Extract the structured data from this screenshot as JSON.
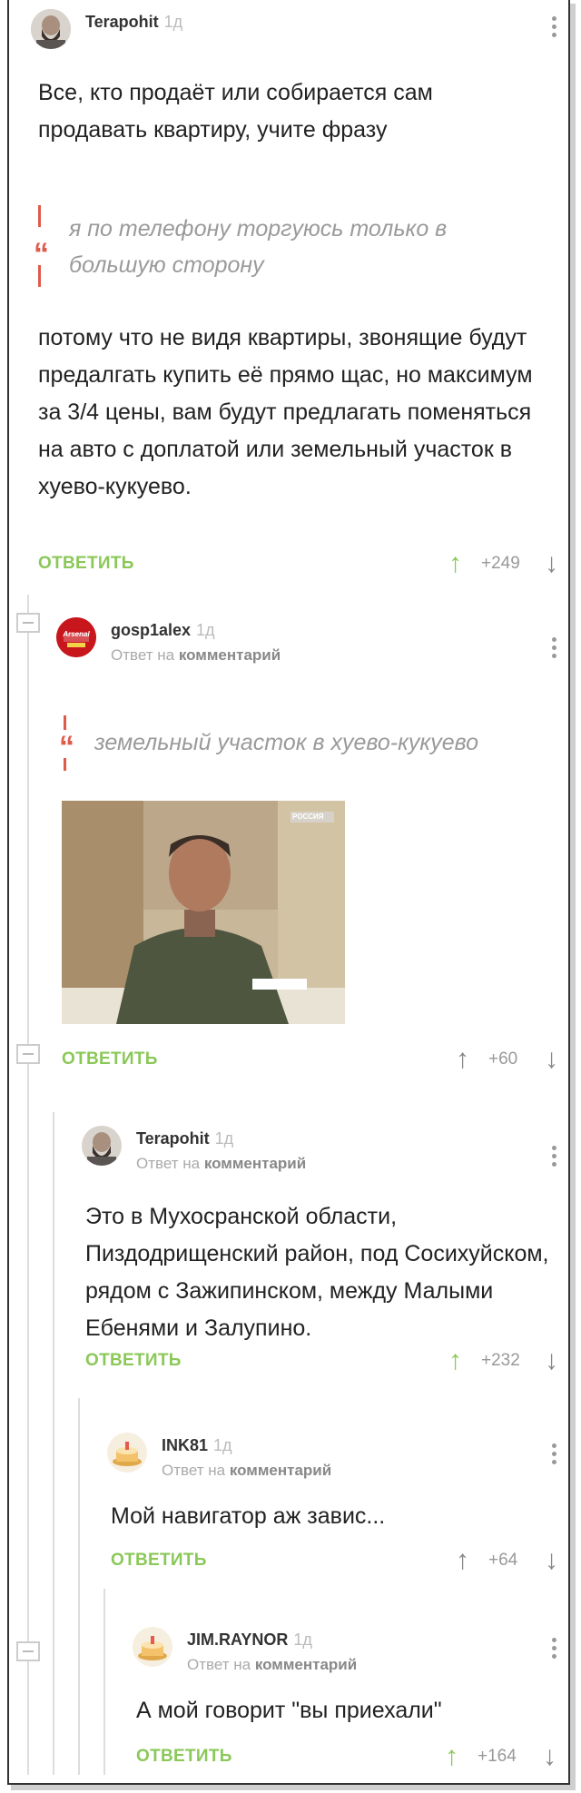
{
  "comments": [
    {
      "username": "Terapohit",
      "time": "1д",
      "paragraph1": "Все, кто продаёт или собирается сам продавать квартиру, учите фразу",
      "quote_line1": "я по телефону торгуюсь только в",
      "quote_line2": "большую сторону",
      "paragraph2": "потому что не видя квартиры, звонящие будут предалгать купить её прямо щас, но максимум за 3/4 цены, вам будут предлагать поменяться на авто с доплатой или земельный участок в хуево-кукуево.",
      "reply_label": "ОТВЕТИТЬ",
      "score": "+249"
    },
    {
      "username": "gosp1alex",
      "time": "1д",
      "reply_to_prefix": "Ответ на",
      "reply_to_link": "комментарий",
      "avatar_text": "Arsenal",
      "quote": "земельный участок в хуево-кукуево",
      "image_badge": "РОССИЯ",
      "reply_label": "ОТВЕТИТЬ",
      "score": "+60"
    },
    {
      "username": "Terapohit",
      "time": "1д",
      "reply_to_prefix": "Ответ на",
      "reply_to_link": "комментарий",
      "text": "Это в Мухосранской области, Пиздодрищенский район, под Сосихуйском, рядом с Зажипинском, между Малыми Ебенями и Залупино.",
      "reply_label": "ОТВЕТИТЬ",
      "score": "+232"
    },
    {
      "username": "INK81",
      "time": "1д",
      "reply_to_prefix": "Ответ на",
      "reply_to_link": "комментарий",
      "text": "Мой навигатор аж завис...",
      "reply_label": "ОТВЕТИТЬ",
      "score": "+64"
    },
    {
      "username": "JIM.RAYNOR",
      "time": "1д",
      "reply_to_prefix": "Ответ на",
      "reply_to_link": "комментарий",
      "text": "А мой говорит \"вы приехали\"",
      "reply_label": "ОТВЕТИТЬ",
      "score": "+164"
    }
  ],
  "icons": {
    "upvote": "arrow-up-icon",
    "downvote": "arrow-down-icon",
    "menu": "more-vertical-icon",
    "collapse": "collapse-branch-icon",
    "quote": "quote-icon"
  },
  "colors": {
    "accent_green": "#8ac858",
    "quote_red": "#e05a4a",
    "meta_grey": "#aaaaaa"
  }
}
